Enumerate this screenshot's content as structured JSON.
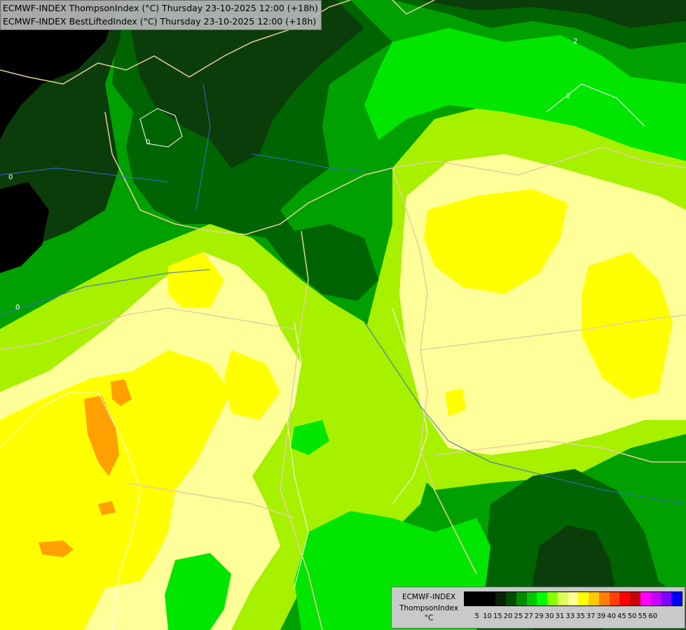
{
  "header": {
    "line1": "ECMWF-INDEX ThompsonIndex (°C) Thursday 23-10-2025 12:00 (+18h)",
    "line2": "ECMWF-INDEX BestLiftedIndex (°C) Thursday 23-10-2025 12:00 (+18h)"
  },
  "legend": {
    "title_model": "ECMWF-INDEX",
    "title_param": "ThompsonIndex",
    "title_unit": "°C",
    "ticks": [
      "5",
      "10",
      "15",
      "20",
      "25",
      "27",
      "29",
      "30",
      "31",
      "33",
      "35",
      "37",
      "39",
      "40",
      "45",
      "50",
      "55",
      "60"
    ],
    "colors": [
      "#000000",
      "#000000",
      "#000000",
      "#0a1f0a",
      "#004d00",
      "#008a00",
      "#00c800",
      "#00ff00",
      "#88ff00",
      "#ddff55",
      "#ffff99",
      "#ffff00",
      "#ffc800",
      "#ff8000",
      "#ff4000",
      "#ff0000",
      "#c80000",
      "#ff00ff",
      "#c800ff",
      "#8000ff",
      "#0000ff"
    ]
  },
  "contour_labels": [
    "0",
    "0",
    "0",
    "2",
    "2"
  ],
  "field_colors": {
    "ti_lt_20": "#000000",
    "ti_20_25": "#0b3d0b",
    "ti_25_27": "#006400",
    "ti_27_29": "#00a000",
    "ti_29_30": "#00e600",
    "ti_30_31": "#a6f000",
    "ti_31_33": "#ffff99",
    "ti_33_35": "#ffff00",
    "ti_35_37": "#ffa000"
  }
}
